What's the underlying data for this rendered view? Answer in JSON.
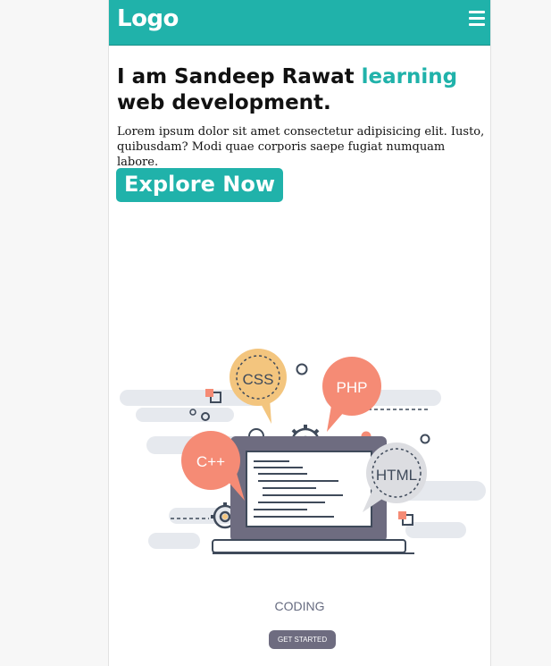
{
  "header": {
    "logo": "Logo",
    "menu_icon": "hamburger-icon"
  },
  "hero": {
    "title_part1": "I am Sandeep Rawat ",
    "title_highlight": "learning",
    "title_part2": " web development.",
    "description": "Lorem ipsum dolor sit amet consectetur adipisicing elit. Iusto, quibusdam? Modi quae corporis saepe fugiat numquam labore.",
    "cta_label": "Explore Now"
  },
  "illustration": {
    "bubbles": [
      "CSS",
      "PHP",
      "C++",
      "HTML"
    ],
    "caption": "CODING",
    "button_label": "GET STARTED"
  },
  "colors": {
    "accent": "#20b2aa",
    "bubble_orange": "#f58b75",
    "bubble_yellow": "#f3c57e",
    "laptop": "#6e6c80"
  }
}
